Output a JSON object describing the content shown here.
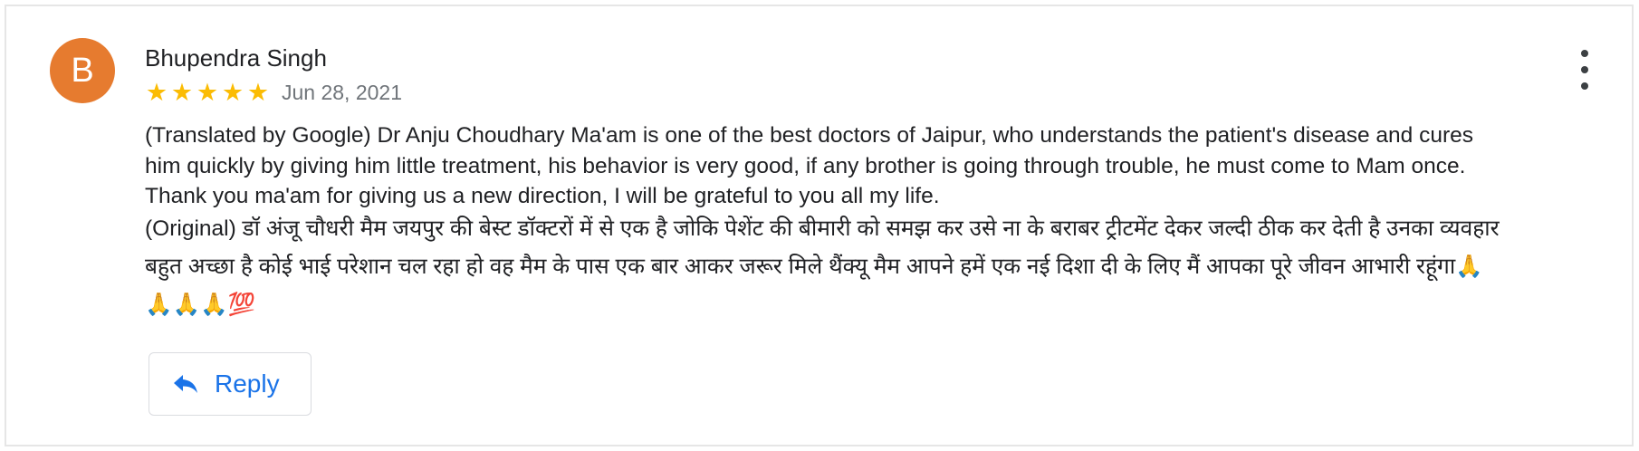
{
  "review": {
    "avatar_initial": "B",
    "avatar_color": "#e67b2f",
    "reviewer_name": "Bhupendra Singh",
    "rating": 5,
    "rating_max": 5,
    "stars": [
      "★",
      "★",
      "★",
      "★",
      "★"
    ],
    "star_color": "#fbbc04",
    "date": "Jun 28, 2021",
    "translated_text": "(Translated by Google) Dr Anju Choudhary Ma'am is one of the best doctors of Jaipur, who understands the patient's disease and cures him quickly by giving him little treatment, his behavior is very good, if any brother is going through trouble, he must come to Mam once. Thank you ma'am for giving us a new direction, I will be grateful to you all my life.",
    "original_text": "(Original) डॉ अंजू चौधरी मैम जयपुर की बेस्ट डॉक्टरों में से एक है जोकि पेशेंट की बीमारी को समझ कर उसे ना के बराबर ट्रीटमेंट देकर जल्दी ठीक कर देती है उनका व्यवहार बहुत अच्छा है कोई भाई परेशान चल रहा हो वह मैम के पास एक बार आकर जरूर मिले थैंक्यू मैम आपने हमें एक नई दिशा दी के लिए मैं आपका पूरे जीवन आभारी रहूंगा🙏🙏🙏🙏💯"
  },
  "actions": {
    "menu_icon": "more-vert-icon",
    "reply_icon": "reply-arrow-icon",
    "reply_label": "Reply",
    "accent_color": "#1a73e8"
  }
}
